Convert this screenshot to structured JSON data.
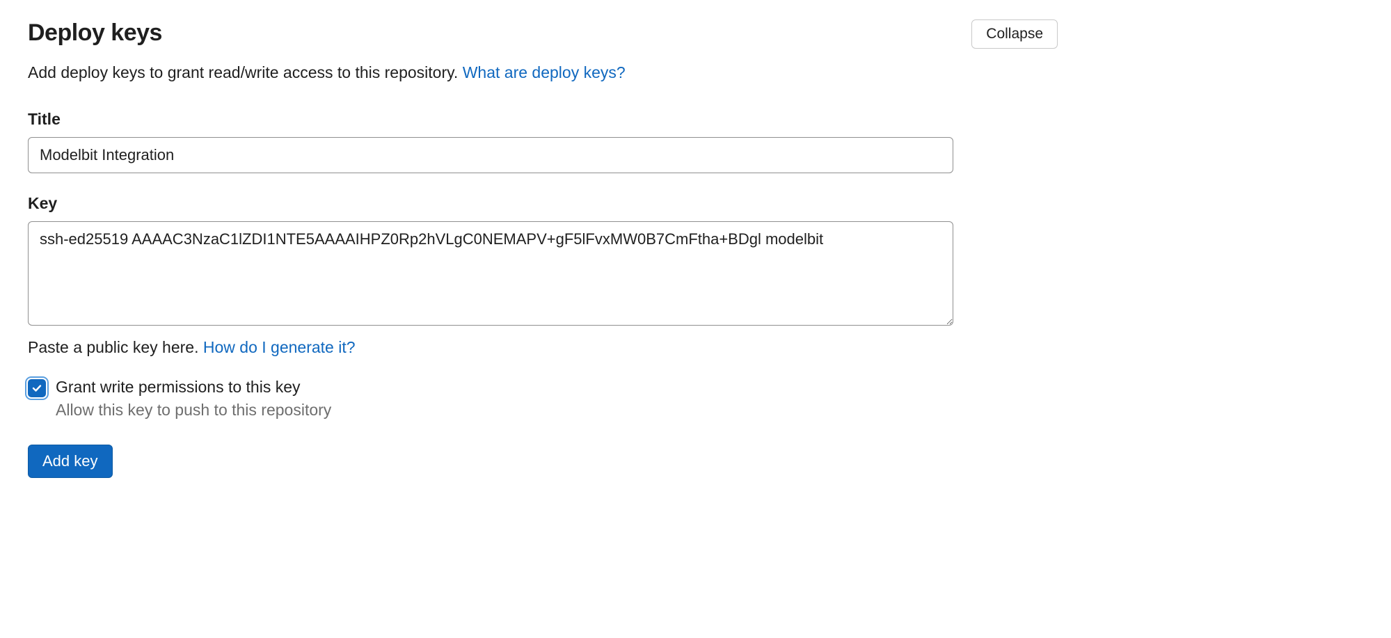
{
  "header": {
    "title": "Deploy keys",
    "collapse_label": "Collapse"
  },
  "description": {
    "text": "Add deploy keys to grant read/write access to this repository. ",
    "link_text": "What are deploy keys?"
  },
  "title_field": {
    "label": "Title",
    "value": "Modelbit Integration"
  },
  "key_field": {
    "label": "Key",
    "value": "ssh-ed25519 AAAAC3NzaC1lZDI1NTE5AAAAIHPZ0Rp2hVLgC0NEMAPV+gF5lFvxMW0B7CmFtha+BDgl modelbit"
  },
  "key_help": {
    "text": "Paste a public key here. ",
    "link_text": "How do I generate it?"
  },
  "write_permission": {
    "checked": true,
    "label": "Grant write permissions to this key",
    "sub_label": "Allow this key to push to this repository"
  },
  "submit": {
    "label": "Add key"
  }
}
